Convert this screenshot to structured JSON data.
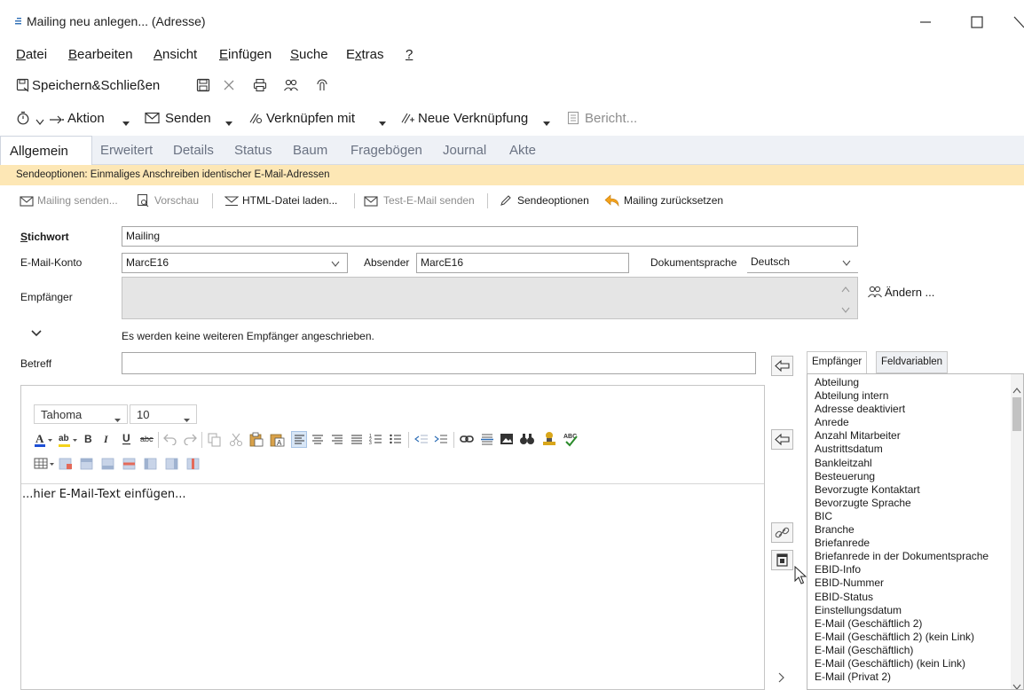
{
  "window": {
    "title": "Mailing neu anlegen... (Adresse)",
    "controls": [
      "minimize",
      "maximize",
      "close"
    ]
  },
  "menu": {
    "items": [
      {
        "key": "D",
        "rest": "atei"
      },
      {
        "key": "B",
        "rest": "earbeiten"
      },
      {
        "key": "A",
        "rest": "nsicht"
      },
      {
        "key": "E",
        "rest": "infügen"
      },
      {
        "key": "S",
        "rest": "uche"
      },
      {
        "pre": "E",
        "key": "x",
        "rest": "tras"
      },
      {
        "key": "?",
        "rest": ""
      }
    ]
  },
  "toolbar1": {
    "save_close": "Speichern&Schließen"
  },
  "toolbar2": {
    "aktion": "Aktion",
    "senden": "Senden",
    "verknuepfen": "Verknüpfen mit",
    "neue_verknuepfung": "Neue Verknüpfung",
    "bericht": "Bericht..."
  },
  "tabs": [
    "Allgemein",
    "Erweitert",
    "Details",
    "Status",
    "Baum",
    "Fragebögen",
    "Journal",
    "Akte"
  ],
  "sendoptions_bar": "Sendeoptionen: Einmaliges Anschreiben identischer E-Mail-Adressen",
  "actions": {
    "mailing_senden": "Mailing senden...",
    "vorschau": "Vorschau",
    "html_laden": "HTML-Datei laden...",
    "test_email": "Test-E-Mail senden",
    "sendeoptionen": "Sendeoptionen",
    "zuruecksetzen": "Mailing zurücksetzen"
  },
  "form": {
    "stichwort_key": "S",
    "stichwort_rest": "tichwort",
    "stichwort_value": "Mailing",
    "email_konto_label": "E-Mail-Konto",
    "email_konto_value": "MarcE16",
    "absender_label": "Absender",
    "absender_value": "MarcE16",
    "dokumentsprache_label": "Dokumentsprache",
    "dokumentsprache_value": "Deutsch",
    "empfaenger_label": "Empfänger",
    "aendern": "Ändern ...",
    "keine_weiteren": "Es werden keine weiteren Empfänger angeschrieben.",
    "betreff_label": "Betreff",
    "betreff_value": ""
  },
  "editor": {
    "font": "Tahoma",
    "size": "10",
    "placeholder": "...hier E-Mail-Text einfügen..."
  },
  "right_panel": {
    "tabs": [
      "Empfänger",
      "Feldvariablen"
    ],
    "items": [
      "Abteilung",
      "Abteilung intern",
      "Adresse deaktiviert",
      "Anrede",
      "Anzahl Mitarbeiter",
      "Austrittsdatum",
      "Bankleitzahl",
      "Besteuerung",
      "Bevorzugte Kontaktart",
      "Bevorzugte Sprache",
      "BIC",
      "Branche",
      "Briefanrede",
      "Briefanrede in der Dokumentsprache",
      "EBID-Info",
      "EBID-Nummer",
      "EBID-Status",
      "Einstellungsdatum",
      "E-Mail (Geschäftlich 2)",
      "E-Mail (Geschäftlich 2) (kein Link)",
      "E-Mail (Geschäftlich)",
      "E-Mail (Geschäftlich) (kein Link)",
      "E-Mail (Privat 2)"
    ]
  },
  "colors": {
    "tabbar_bg": "#eef1f6",
    "sendopt_bg": "#fde7b5",
    "accent_blue": "#2d6db5"
  }
}
